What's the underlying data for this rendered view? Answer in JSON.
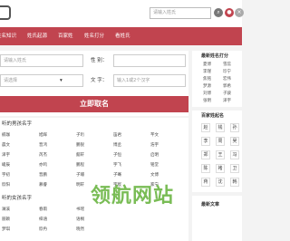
{
  "header": {
    "search_placeholder": "请输入姓氏",
    "icons": [
      "search-icon",
      "user-icon",
      "close-icon"
    ]
  },
  "nav": {
    "items": [
      "姓名知识",
      "姓氏起源",
      "百家姓",
      "姓名打分",
      "看姓氏"
    ]
  },
  "form": {
    "surname_placeholder": "请输入姓氏",
    "gender_label": "性 别：",
    "birth_placeholder": "请选择",
    "words_label": "文 字：",
    "words_placeholder": "输入1或2个汉字",
    "submit_label": "立即取名"
  },
  "boys": {
    "title": "听的男孩名字",
    "rows": [
      [
        "楠珈",
        "旭辉",
        "子珩",
        "笛君",
        "芊文"
      ],
      [
        "晨文",
        "晋鸿",
        "鹏锐",
        "博丞",
        "浩宇"
      ],
      [
        "泽宇",
        "芮杰",
        "懿轩",
        "子恒",
        "启明"
      ],
      [
        "峻辰",
        "亦鸣",
        "鹏程",
        "宇飞",
        "铭堂"
      ],
      [
        "宇初",
        "晋鹏",
        "子璿",
        "子骞",
        "文博"
      ],
      [
        "欣阳",
        "慕睿",
        "明轩",
        "宇宸",
        "家宁"
      ]
    ]
  },
  "girls": {
    "title": "听的女孩名字",
    "rows": [
      [
        "澜溪",
        "春雨",
        "书瑶"
      ],
      [
        "丽颖",
        "梓涵",
        "语桐"
      ],
      [
        "梦琪",
        "欣冉",
        "晓然"
      ]
    ]
  },
  "sidebar": {
    "score_title": "最新姓名打分",
    "score_names": [
      [
        "夏博",
        "雪蕊"
      ],
      [
        "李瑾",
        "珍宁"
      ],
      [
        "焦铭",
        "宏伟"
      ],
      [
        "梦源",
        "郭希"
      ],
      [
        "刘博",
        "子骏"
      ],
      [
        "张明",
        "泽宇"
      ]
    ],
    "surname_title": "百家姓起名",
    "surnames": [
      [
        "赵",
        "钱",
        "孙"
      ],
      [
        "李",
        "周",
        "吴"
      ],
      [
        "郑",
        "王",
        "冯"
      ],
      [
        "陈",
        "褚",
        "卫"
      ],
      [
        "蒋",
        "沈",
        "韩"
      ]
    ],
    "article_title": "最新文章"
  },
  "watermark": "领航网站"
}
